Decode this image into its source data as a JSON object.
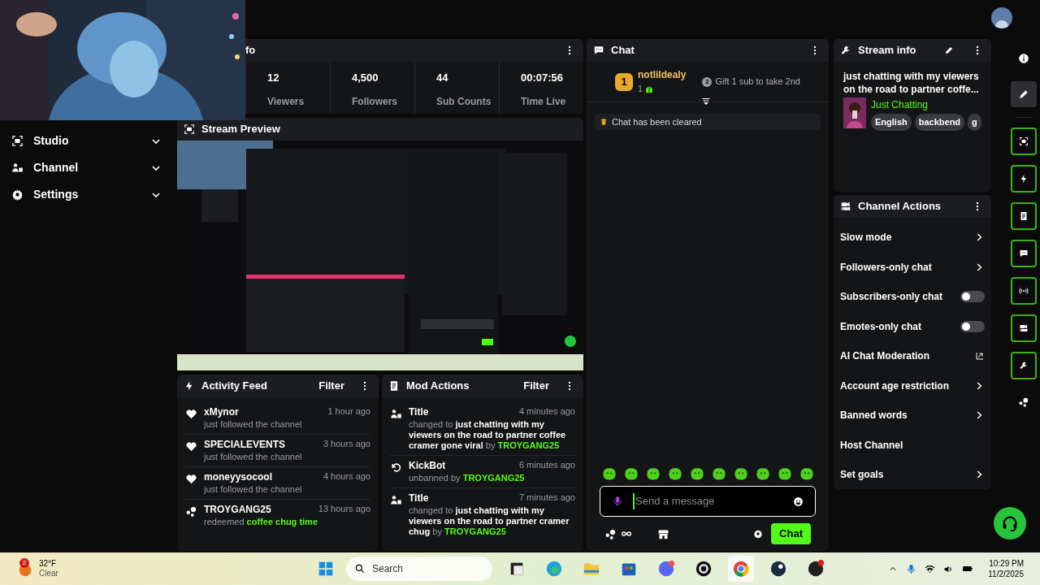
{
  "stream_info_panel": {
    "title": "fo",
    "stats": [
      {
        "value": "12",
        "label": "Viewers"
      },
      {
        "value": "4,500",
        "label": "Followers"
      },
      {
        "value": "44",
        "label": "Sub Counts"
      },
      {
        "value": "00:07:56",
        "label": "Time Live"
      }
    ]
  },
  "sidebar": {
    "items": [
      {
        "kind": "studio",
        "label": "Studio"
      },
      {
        "kind": "channel",
        "label": "Channel"
      },
      {
        "kind": "settings",
        "label": "Settings"
      }
    ]
  },
  "stream_preview": {
    "title": "Stream Preview"
  },
  "activity_feed": {
    "title": "Activity Feed",
    "filter": "Filter",
    "items": [
      {
        "kind": "follow",
        "user": "xMynor",
        "time": "1 hour ago",
        "prefix": "just followed the channel"
      },
      {
        "kind": "follow",
        "user": "SPECIALEVENTS",
        "time": "3 hours ago",
        "prefix": "just followed the channel"
      },
      {
        "kind": "follow",
        "user": "moneyysocool",
        "time": "4 hours ago",
        "prefix": "just followed the channel"
      },
      {
        "kind": "redeem",
        "user": "TROYGANG25",
        "time": "13 hours ago",
        "prefix": "redeemed",
        "actor": "coffee chug time"
      }
    ]
  },
  "mod_actions": {
    "title": "Mod Actions",
    "filter": "Filter",
    "items": [
      {
        "kind": "title",
        "name": "Title",
        "time": "4 minutes ago",
        "prefix": "changed to",
        "subject": "just chatting with my viewers on the road to partner coffee cramer gone viral",
        "by": "by",
        "actor": "TROYGANG25"
      },
      {
        "kind": "unban",
        "name": "KickBot",
        "time": "6 minutes ago",
        "prefix": "unbanned by",
        "actor": "TROYGANG25"
      },
      {
        "kind": "title",
        "name": "Title",
        "time": "7 minutes ago",
        "prefix": "changed to",
        "subject": "just chatting with my viewers on the road to partner cramer chug",
        "by": "by",
        "actor": "TROYGANG25"
      }
    ]
  },
  "chat": {
    "title": "Chat",
    "leader": {
      "rank": "1",
      "name": "notlildealy",
      "count": "1",
      "next_rank": "2",
      "gift": "Gift 1 sub to take 2nd"
    },
    "system_message": "Chat has been cleared",
    "placeholder": "Send a message",
    "send": "Chat"
  },
  "stream_info": {
    "title": "Stream info",
    "description": "just chatting with my viewers on the road to partner coffe...",
    "category": "Just Chatting",
    "tags": [
      "English",
      "backbend",
      "g"
    ]
  },
  "channel_actions": {
    "title": "Channel Actions",
    "items": [
      {
        "kind": "arrow",
        "label": "Slow mode"
      },
      {
        "kind": "arrow",
        "label": "Followers-only chat"
      },
      {
        "kind": "toggle",
        "label": "Subscribers-only chat",
        "on": false
      },
      {
        "kind": "toggle",
        "label": "Emotes-only chat",
        "on": false
      },
      {
        "kind": "external",
        "label": "AI Chat Moderation"
      },
      {
        "kind": "arrow",
        "label": "Account age restriction"
      },
      {
        "kind": "arrow",
        "label": "Banned words"
      },
      {
        "kind": "plain",
        "label": "Host Channel"
      },
      {
        "kind": "arrow",
        "label": "Set goals"
      }
    ]
  },
  "rail": {
    "top": [
      {
        "kind": "info",
        "selected": false
      },
      {
        "kind": "pencil",
        "selected": true
      }
    ],
    "tools": [
      {
        "kind": "studio",
        "selected": false
      },
      {
        "kind": "bolt",
        "selected": false
      },
      {
        "kind": "doc",
        "selected": false
      },
      {
        "kind": "chat",
        "selected": false
      },
      {
        "kind": "broadcast",
        "selected": false
      },
      {
        "kind": "camera",
        "selected": false
      },
      {
        "kind": "wrench",
        "selected": false
      }
    ]
  },
  "taskbar": {
    "weather": {
      "badge": "2",
      "temperature": "32°F",
      "condition": "Clear"
    },
    "placeholder": "Search",
    "apps": [
      {
        "kind": "files",
        "selected": false
      },
      {
        "kind": "edge",
        "selected": false
      },
      {
        "kind": "folder",
        "selected": false
      },
      {
        "kind": "store",
        "selected": false
      },
      {
        "kind": "discord",
        "selected": false
      },
      {
        "kind": "g",
        "selected": false
      },
      {
        "kind": "chrome",
        "selected": true
      },
      {
        "kind": "steam",
        "selected": false
      },
      {
        "kind": "obs",
        "selected": false
      }
    ],
    "time": "10:29 PM",
    "date": "11/2/2025"
  }
}
